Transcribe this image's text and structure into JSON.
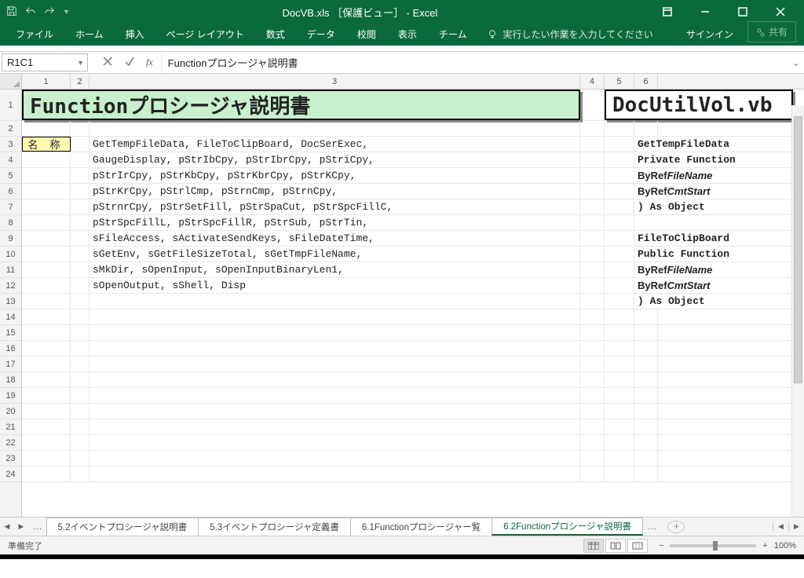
{
  "window": {
    "title": "DocVB.xls ［保護ビュー］ - Excel",
    "signin": "サインイン",
    "share": "共有"
  },
  "ribbon_tabs": [
    "ファイル",
    "ホーム",
    "挿入",
    "ページ レイアウト",
    "数式",
    "データ",
    "校閲",
    "表示",
    "チーム"
  ],
  "tellme": "実行したい作業を入力してください",
  "namebox": "R1C1",
  "formula": "Functionプロシージャ説明書",
  "columns": [
    "1",
    "2",
    "3",
    "4",
    "5",
    "6"
  ],
  "row_numbers": [
    "1",
    "2",
    "3",
    "4",
    "5",
    "6",
    "7",
    "8",
    "9",
    "10",
    "11",
    "12",
    "13",
    "14",
    "15",
    "16",
    "17",
    "18",
    "19",
    "20",
    "21",
    "22",
    "23",
    "24"
  ],
  "doc_title": "Functionプロシージャ説明書",
  "module_title": "DocUtilVol.vb",
  "label_name": "名 称",
  "left_lines": [
    "GetTempFileData, FileToClipBoard, DocSerExec,",
    "GaugeDisplay, pStrIbCpy, pStrIbrCpy, pStriCpy,",
    "pStrIrCpy, pStrKbCpy, pStrKbrCpy, pStrKCpy,",
    "pStrKrCpy, pStrlCmp, pStrnCmp, pStrnCpy,",
    "pStrnrCpy, pStrSetFill, pStrSpaCut, pStrSpcFillC,",
    "pStrSpcFillL, pStrSpcFillR, pStrSub, pStrTin,",
    "sFileAccess, sActivateSendKeys, sFileDateTime,",
    "sGetEnv, sGetFileSizeTotal, sGetTmpFileName,",
    "sMkDir, sOpenInput, sOpenInputBinaryLen1,",
    "sOpenOutput, sShell, Disp"
  ],
  "right_lines": [
    {
      "t": "GetTempFileData",
      "b": true
    },
    {
      "t": "Private Function",
      "b": true
    },
    {
      "t": "    ByRef ",
      "b": true,
      "suf": "FileName",
      "i": true
    },
    {
      "t": "    ByRef ",
      "b": true,
      "suf": "CmtStart",
      "i": true
    },
    {
      "t": ") As Object",
      "b": true
    },
    {
      "t": ""
    },
    {
      "t": "FileToClipBoard",
      "b": true
    },
    {
      "t": "Public Function",
      "b": true
    },
    {
      "t": "    ByRef ",
      "b": true,
      "suf": "FileName",
      "i": true
    },
    {
      "t": "    ByRef ",
      "b": true,
      "suf": "CmtStart",
      "i": true
    },
    {
      "t": ") As Object",
      "b": true
    }
  ],
  "sheet_tabs": [
    "5.2イベントプロシージャ説明書",
    "5.3イベントプロシージャ定義書",
    "6.1Functionプロシージャー覧",
    "6.2Functionプロシージャ説明書"
  ],
  "active_tab_index": 3,
  "status_text": "準備完了",
  "zoom": "100%"
}
